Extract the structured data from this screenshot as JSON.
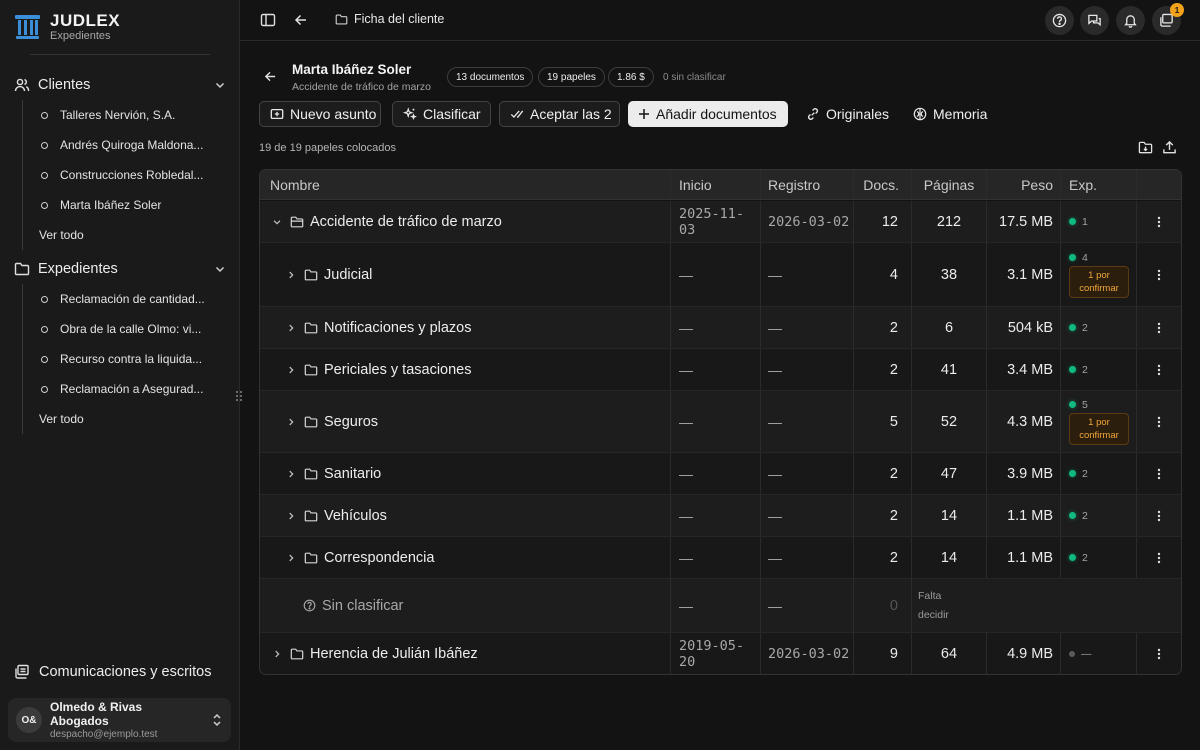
{
  "brand": {
    "name": "JUDLEX",
    "subtitle": "Expedientes"
  },
  "sidebar": {
    "clients": {
      "label": "Clientes",
      "items": [
        "Talleres Nervión, S.A.",
        "Andrés Quiroga Maldona...",
        "Construcciones Robledal...",
        "Marta Ibáñez Soler"
      ],
      "more": "Ver todo"
    },
    "cases": {
      "label": "Expedientes",
      "items": [
        "Reclamación de cantidad...",
        "Obra de la calle Olmo: vi...",
        "Recurso contra la liquida...",
        "Reclamación a Asegurad..."
      ],
      "more": "Ver todo"
    },
    "comms": "Comunicaciones y escritos",
    "account": {
      "initials": "O&",
      "name": "Olmedo & Rivas Abogados",
      "email": "despacho@ejemplo.test"
    }
  },
  "topbar": {
    "breadcrumb": "Ficha del cliente",
    "notifications_count": "1"
  },
  "client": {
    "name": "Marta Ibáñez Soler",
    "subtitle": "Accidente de tráfico de marzo",
    "chips": [
      "13 documentos",
      "19 papeles",
      "1.86 $"
    ],
    "unclassified": "0 sin clasificar"
  },
  "toolbar": {
    "new_case": "Nuevo asunto",
    "classify": "Clasificar",
    "accept": "Aceptar las 2",
    "add_docs": "Añadir documentos",
    "originals": "Originales",
    "memory": "Memoria"
  },
  "placed_status": "19 de 19 papeles colocados",
  "table": {
    "headers": {
      "name": "Nombre",
      "start": "Inicio",
      "registry": "Registro",
      "docs": "Docs.",
      "pages": "Páginas",
      "weight": "Peso",
      "exp": "Exp."
    },
    "dash": "—",
    "pending_label_1": "1 por",
    "pending_label_2": "confirmar",
    "missing_1": "Falta",
    "missing_2": "decidir",
    "rows": [
      {
        "name": "Accidente de tráfico de marzo",
        "start": "2025-11-03",
        "registry": "2026-03-02",
        "docs": "12",
        "pages": "212",
        "weight": "17.5 MB",
        "exp": "1"
      },
      {
        "name": "Judicial",
        "docs": "4",
        "pages": "38",
        "weight": "3.1 MB",
        "exp": "4"
      },
      {
        "name": "Notificaciones y plazos",
        "docs": "2",
        "pages": "6",
        "weight": "504 kB",
        "exp": "2"
      },
      {
        "name": "Periciales y tasaciones",
        "docs": "2",
        "pages": "41",
        "weight": "3.4 MB",
        "exp": "2"
      },
      {
        "name": "Seguros",
        "docs": "5",
        "pages": "52",
        "weight": "4.3 MB",
        "exp": "5"
      },
      {
        "name": "Sanitario",
        "docs": "2",
        "pages": "47",
        "weight": "3.9 MB",
        "exp": "2"
      },
      {
        "name": "Vehículos",
        "docs": "2",
        "pages": "14",
        "weight": "1.1 MB",
        "exp": "2"
      },
      {
        "name": "Correspondencia",
        "docs": "2",
        "pages": "14",
        "weight": "1.1 MB",
        "exp": "2"
      },
      {
        "name": "Sin clasificar",
        "docs": "0"
      },
      {
        "name": "Herencia de Julián Ibáñez",
        "start": "2019-05-20",
        "registry": "2026-03-02",
        "docs": "9",
        "pages": "64",
        "weight": "4.9 MB",
        "exp": "—"
      }
    ]
  },
  "colors": {
    "accent_green": "#10b981",
    "warning": "#f2a31b",
    "brand_blue": "#3b8fd9"
  }
}
